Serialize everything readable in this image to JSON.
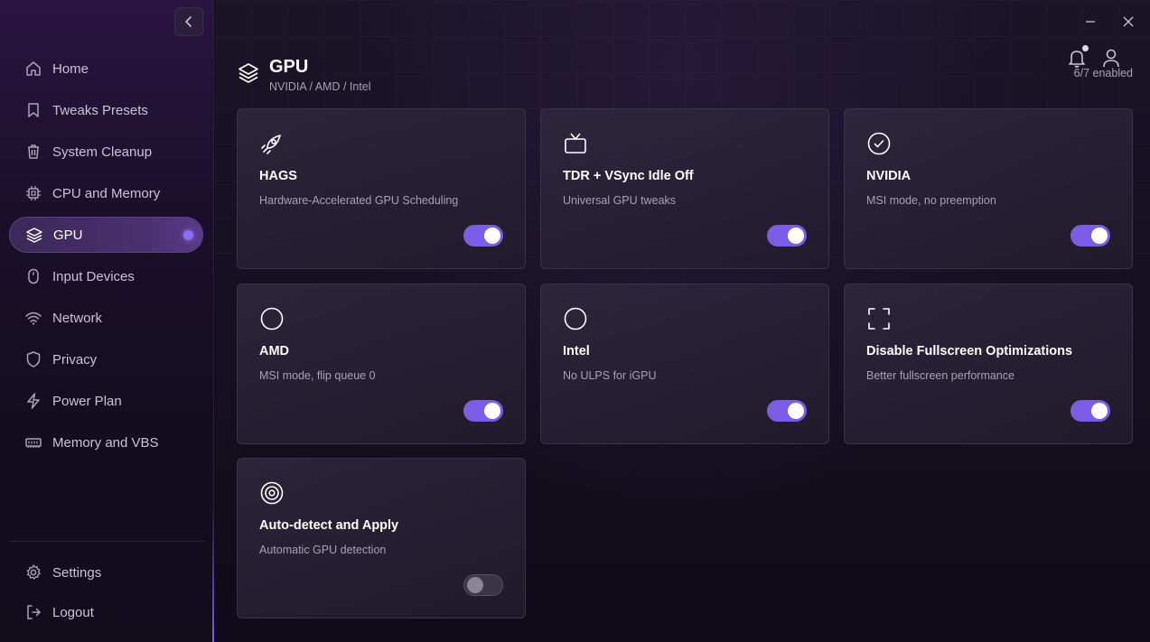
{
  "sidebar": {
    "items": [
      {
        "label": "Home",
        "icon": "home-icon"
      },
      {
        "label": "Tweaks Presets",
        "icon": "bookmark-icon"
      },
      {
        "label": "System Cleanup",
        "icon": "trash-icon"
      },
      {
        "label": "CPU and Memory",
        "icon": "cpu-icon"
      },
      {
        "label": "GPU",
        "icon": "layers-icon",
        "active": true
      },
      {
        "label": "Input Devices",
        "icon": "mouse-icon"
      },
      {
        "label": "Network",
        "icon": "wifi-icon"
      },
      {
        "label": "Privacy",
        "icon": "shield-icon"
      },
      {
        "label": "Power Plan",
        "icon": "bolt-icon"
      },
      {
        "label": "Memory and VBS",
        "icon": "memory-icon"
      }
    ],
    "bottom": [
      {
        "label": "Settings",
        "icon": "gear-icon"
      },
      {
        "label": "Logout",
        "icon": "logout-icon"
      }
    ]
  },
  "header": {
    "title": "GPU",
    "subtitle": "NVIDIA / AMD / Intel",
    "enabled_count": "6/7 enabled"
  },
  "cards": [
    {
      "title": "HAGS",
      "desc": "Hardware-Accelerated GPU Scheduling",
      "icon": "rocket-icon",
      "enabled": true
    },
    {
      "title": "TDR + VSync Idle Off",
      "desc": "Universal GPU tweaks",
      "icon": "tv-icon",
      "enabled": true
    },
    {
      "title": "NVIDIA",
      "desc": "MSI mode, no preemption",
      "icon": "check-circle-icon",
      "enabled": true
    },
    {
      "title": "AMD",
      "desc": "MSI mode, flip queue 0",
      "icon": "circle-icon",
      "enabled": true
    },
    {
      "title": "Intel",
      "desc": "No ULPS for iGPU",
      "icon": "circle-icon",
      "enabled": true
    },
    {
      "title": "Disable Fullscreen Optimizations",
      "desc": "Better fullscreen performance",
      "icon": "fullscreen-icon",
      "enabled": true
    },
    {
      "title": "Auto-detect and Apply",
      "desc": "Automatic GPU detection",
      "icon": "target-icon",
      "enabled": false
    }
  ],
  "colors": {
    "accent": "#7a5ce6",
    "active_dot": "#8a6ef0"
  }
}
